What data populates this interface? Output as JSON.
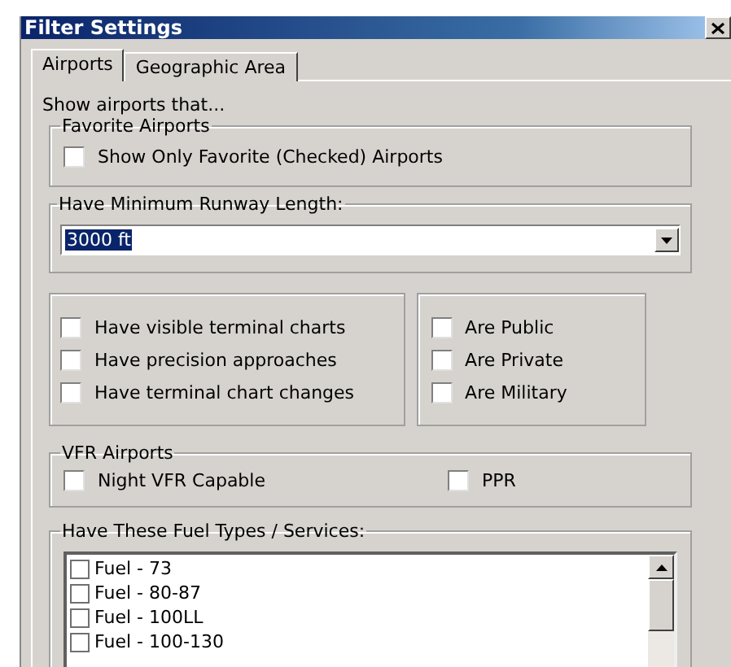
{
  "window": {
    "title": "Filter Settings"
  },
  "tabs": [
    {
      "label": "Airports",
      "selected": true
    },
    {
      "label": "Geographic Area",
      "selected": false
    }
  ],
  "intro": "Show airports that...",
  "favorite_group": {
    "title": "Favorite Airports",
    "options": [
      {
        "label": "Show Only Favorite (Checked) Airports",
        "checked": false
      }
    ]
  },
  "runway_group": {
    "title": "Have Minimum Runway Length:",
    "value": "3000 ft",
    "value_selected": true
  },
  "chart_options": [
    {
      "label": "Have visible terminal charts",
      "checked": false
    },
    {
      "label": "Have precision approaches",
      "checked": false
    },
    {
      "label": "Have terminal chart changes",
      "checked": false
    }
  ],
  "type_options": [
    {
      "label": "Are Public",
      "checked": false
    },
    {
      "label": "Are Private",
      "checked": false
    },
    {
      "label": "Are Military",
      "checked": false
    }
  ],
  "vfr_group": {
    "title": "VFR Airports",
    "options": [
      {
        "label": "Night VFR Capable",
        "checked": false
      },
      {
        "label": "PPR",
        "checked": false
      }
    ]
  },
  "fuel_group": {
    "title": "Have These Fuel Types / Services:",
    "items": [
      {
        "label": "Fuel - 73",
        "checked": false
      },
      {
        "label": "Fuel - 80-87",
        "checked": false
      },
      {
        "label": "Fuel - 100LL",
        "checked": false
      },
      {
        "label": "Fuel - 100-130",
        "checked": false
      }
    ]
  }
}
